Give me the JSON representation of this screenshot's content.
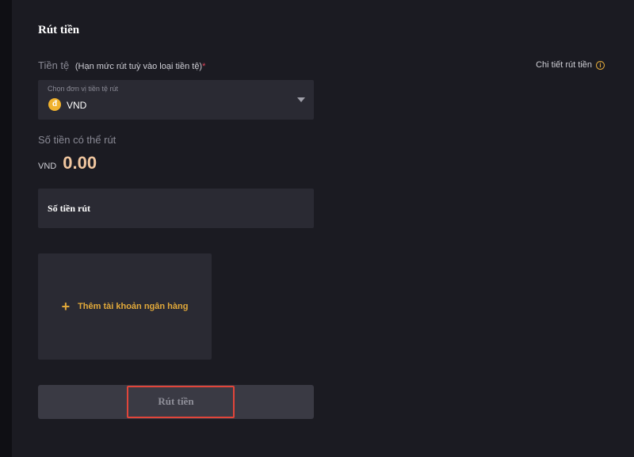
{
  "title": "Rút tiền",
  "currency": {
    "label": "Tiền tệ",
    "note": "(Hạn mức rút tuỳ vào loại tiền tệ)",
    "required_mark": "*",
    "detail_link": "Chi tiết rút tiền",
    "detail_icon": "info-icon",
    "select": {
      "hint": "Chọn đơn vị tiền tệ rút",
      "coin_symbol": "đ",
      "value": "VND",
      "icon": "chevron-down-icon"
    }
  },
  "available": {
    "label": "Số tiền có thể rút",
    "currency": "VND",
    "amount": "0.00"
  },
  "withdraw_amount": {
    "placeholder": "Số tiền rút"
  },
  "add_bank": {
    "icon_symbol": "+",
    "label": "Thêm tài khoản ngân hàng"
  },
  "submit": {
    "label": "Rút tiền"
  },
  "colors": {
    "accent": "#e2a93a",
    "amount": "#f1c7a0",
    "highlight": "#e2453a",
    "panel": "#1b1b22",
    "field": "#2a2a33"
  }
}
